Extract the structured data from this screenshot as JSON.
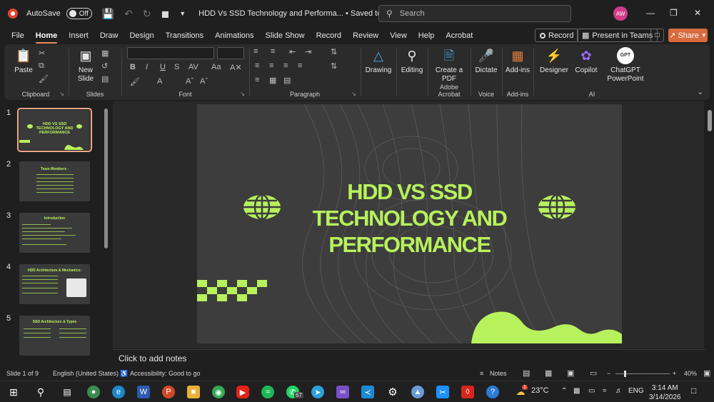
{
  "titlebar": {
    "autosave_label": "AutoSave",
    "autosave_state": "Off",
    "doc_title": "HDD Vs SSD Technology and Performa... • Saved to this PC",
    "search_placeholder": "Search",
    "avatar_initials": "AW"
  },
  "menu": {
    "tabs": [
      "File",
      "Home",
      "Insert",
      "Draw",
      "Design",
      "Transitions",
      "Animations",
      "Slide Show",
      "Record",
      "Review",
      "View",
      "Help",
      "Acrobat"
    ],
    "active": "Home",
    "record_label": "Record",
    "teams_label": "Present in Teams",
    "share_label": "Share"
  },
  "ribbon": {
    "paste_label": "Paste",
    "clipboard_label": "Clipboard",
    "new_slide_label": "New Slide",
    "slides_label": "Slides",
    "font_label": "Font",
    "paragraph_label": "Paragraph",
    "drawing_label": "Drawing",
    "editing_label": "Editing",
    "create_pdf_label": "Create a PDF",
    "adobe_label": "Adobe Acrobat",
    "dictate_label": "Dictate",
    "voice_label": "Voice",
    "addins_btn_label": "Add-ins",
    "addins_label": "Add-ins",
    "designer_label": "Designer",
    "copilot_label": "Copilot",
    "chatgpt_label": "ChatGPT PowerPoint",
    "ai_label": "AI"
  },
  "thumbnails": [
    {
      "number": "1",
      "title": "HDD VS SSD TECHNOLOGY AND PERFORMANCE"
    },
    {
      "number": "2",
      "title": "Team Members -"
    },
    {
      "number": "3",
      "title": "Introduction"
    },
    {
      "number": "4",
      "title": "HDD Architecture & Mechanics:"
    },
    {
      "number": "5",
      "title": "SSD Architecture & Types"
    }
  ],
  "slide": {
    "title_line1": "HDD VS SSD",
    "title_line2": "TECHNOLOGY AND",
    "title_line3": "PERFORMANCE"
  },
  "notes_placeholder": "Click to add notes",
  "status": {
    "slide_counter": "Slide 1 of 9",
    "language": "English (United States)",
    "accessibility": "Accessibility: Good to go",
    "notes_btn": "Notes",
    "zoom": "40%"
  },
  "taskbar": {
    "whatsapp_badge": "67",
    "weather_temp": "23°C",
    "weather_badge": "1",
    "lang": "ENG",
    "time": "3:14 AM",
    "date": "3/14/2026"
  },
  "colors": {
    "accent": "#b7f15c",
    "share": "#d96b3f",
    "slide_bg": "#3d3d3d"
  }
}
